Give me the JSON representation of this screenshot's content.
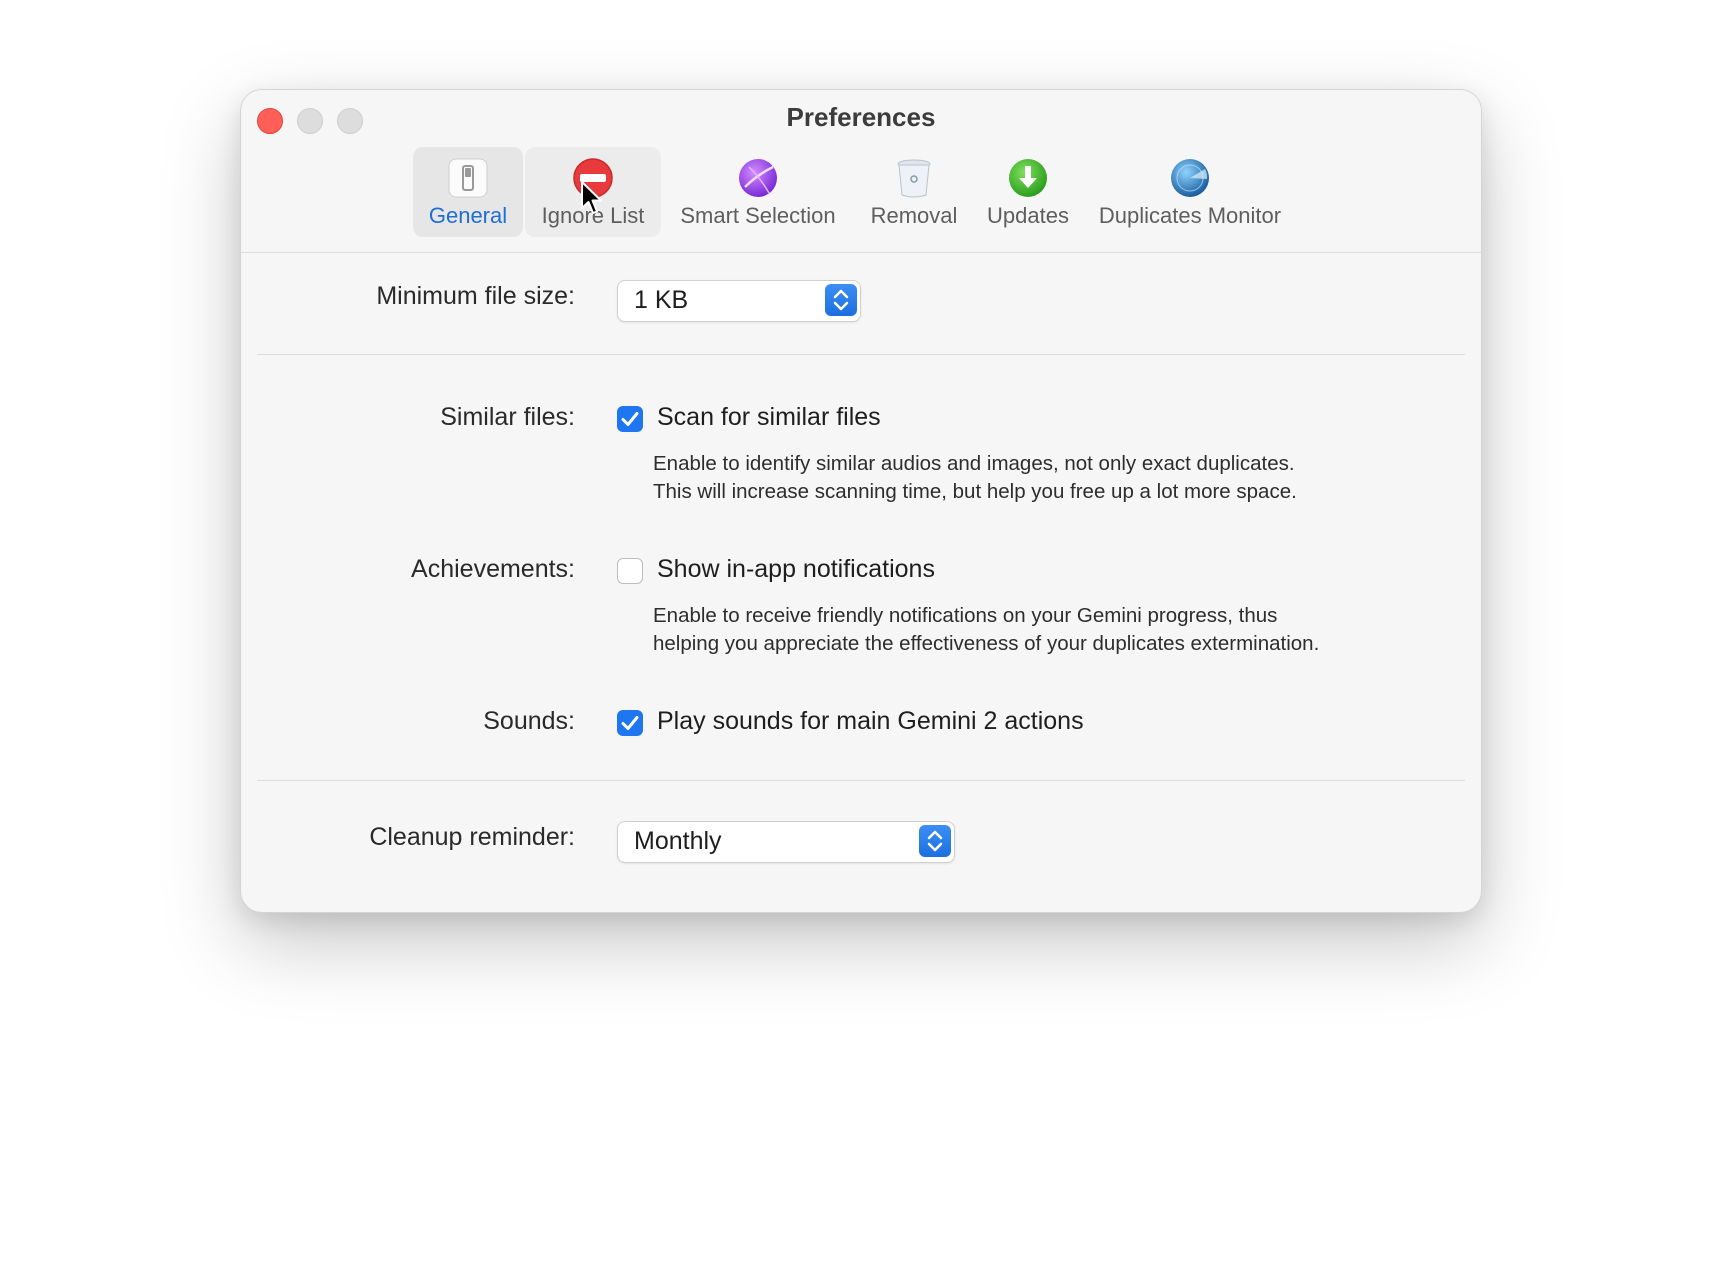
{
  "window": {
    "title": "Preferences"
  },
  "tabs": [
    {
      "label": "General",
      "icon": "switch-icon",
      "active": true
    },
    {
      "label": "Ignore List",
      "icon": "no-entry-icon"
    },
    {
      "label": "Smart Selection",
      "icon": "purple-sphere-icon"
    },
    {
      "label": "Removal",
      "icon": "trash-bin-icon"
    },
    {
      "label": "Updates",
      "icon": "download-arrow-icon"
    },
    {
      "label": "Duplicates Monitor",
      "icon": "radar-globe-icon"
    }
  ],
  "settings": {
    "min_file_size": {
      "label": "Minimum file size:",
      "value": "1 KB"
    },
    "similar_files": {
      "label": "Similar files:",
      "checkbox_label": "Scan for similar files",
      "checked": true,
      "description_line1": "Enable to identify similar audios and images, not only exact duplicates.",
      "description_line2": "This will increase scanning time, but help you free up a lot more space."
    },
    "achievements": {
      "label": "Achievements:",
      "checkbox_label": "Show in-app notifications",
      "checked": false,
      "description_line1": "Enable to receive friendly notifications on your Gemini progress, thus",
      "description_line2": "helping you appreciate the effectiveness of your duplicates extermination."
    },
    "sounds": {
      "label": "Sounds:",
      "checkbox_label": "Play sounds for main Gemini 2 actions",
      "checked": true
    },
    "cleanup_reminder": {
      "label": "Cleanup reminder:",
      "value": "Monthly"
    }
  },
  "colors": {
    "accent": "#1e77f0",
    "close": "#ff5f57"
  }
}
